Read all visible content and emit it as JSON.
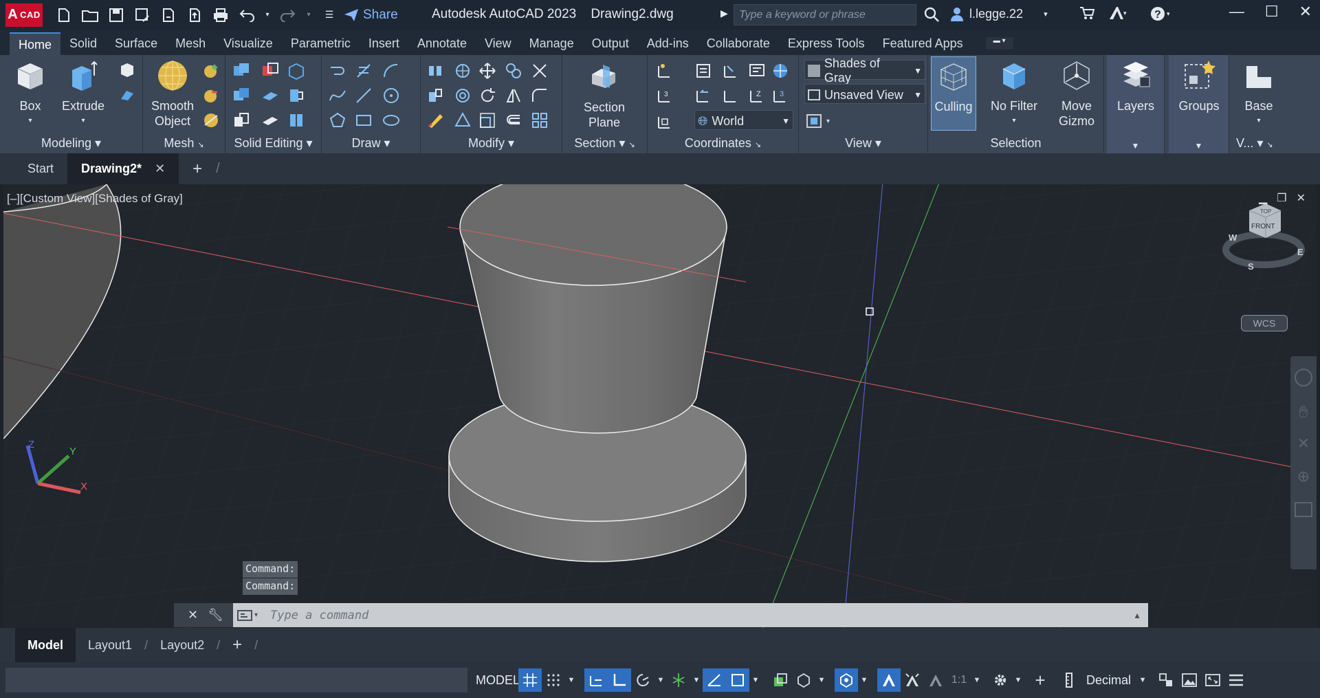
{
  "app": {
    "logo_letter": "A",
    "logo_text": "CAD",
    "title": "Autodesk AutoCAD 2023",
    "document": "Drawing2.dwg",
    "share_label": "Share",
    "search_placeholder": "Type a keyword or phrase",
    "user": "l.legge.22"
  },
  "ribbon_tabs": [
    "Home",
    "Solid",
    "Surface",
    "Mesh",
    "Visualize",
    "Parametric",
    "Insert",
    "Annotate",
    "View",
    "Manage",
    "Output",
    "Add-ins",
    "Collaborate",
    "Express Tools",
    "Featured Apps"
  ],
  "ribbon": {
    "modeling": {
      "title": "Modeling",
      "box": "Box",
      "extrude": "Extrude"
    },
    "mesh": {
      "title": "Mesh",
      "smooth_object_1": "Smooth",
      "smooth_object_2": "Object"
    },
    "solid_editing": {
      "title": "Solid Editing"
    },
    "draw": {
      "title": "Draw"
    },
    "modify": {
      "title": "Modify"
    },
    "section": {
      "title": "Section",
      "section_plane_1": "Section",
      "section_plane_2": "Plane"
    },
    "coordinates": {
      "title": "Coordinates",
      "world": "World"
    },
    "view": {
      "title": "View",
      "visual_style": "Shades of Gray",
      "named_view": "Unsaved View"
    },
    "selection": {
      "title": "Selection",
      "culling": "Culling",
      "no_filter": "No Filter",
      "move_gizmo_1": "Move",
      "move_gizmo_2": "Gizmo"
    },
    "layers": {
      "label": "Layers"
    },
    "groups": {
      "label": "Groups"
    },
    "base": {
      "label": "Base",
      "title": "V..."
    }
  },
  "file_tabs": {
    "start": "Start",
    "drawing": "Drawing2*"
  },
  "viewport": {
    "label": "[–][Custom View][Shades of Gray]",
    "viewcube_top": "TOP",
    "viewcube_front": "FRONT",
    "compass_w": "W",
    "compass_e": "E",
    "compass_s": "S",
    "wcs": "WCS",
    "ucs_x": "X",
    "ucs_y": "Y",
    "ucs_z": "Z"
  },
  "command": {
    "history": [
      "Command:",
      "Command:"
    ],
    "placeholder": "Type a command"
  },
  "layout_tabs": [
    "Model",
    "Layout1",
    "Layout2"
  ],
  "status": {
    "model": "MODEL",
    "scale": "1:1",
    "units": "Decimal"
  },
  "colors": {
    "accent": "#2f6fbf",
    "x_axis": "#e06060",
    "y_axis": "#55c055",
    "z_axis": "#5a6ee0"
  }
}
